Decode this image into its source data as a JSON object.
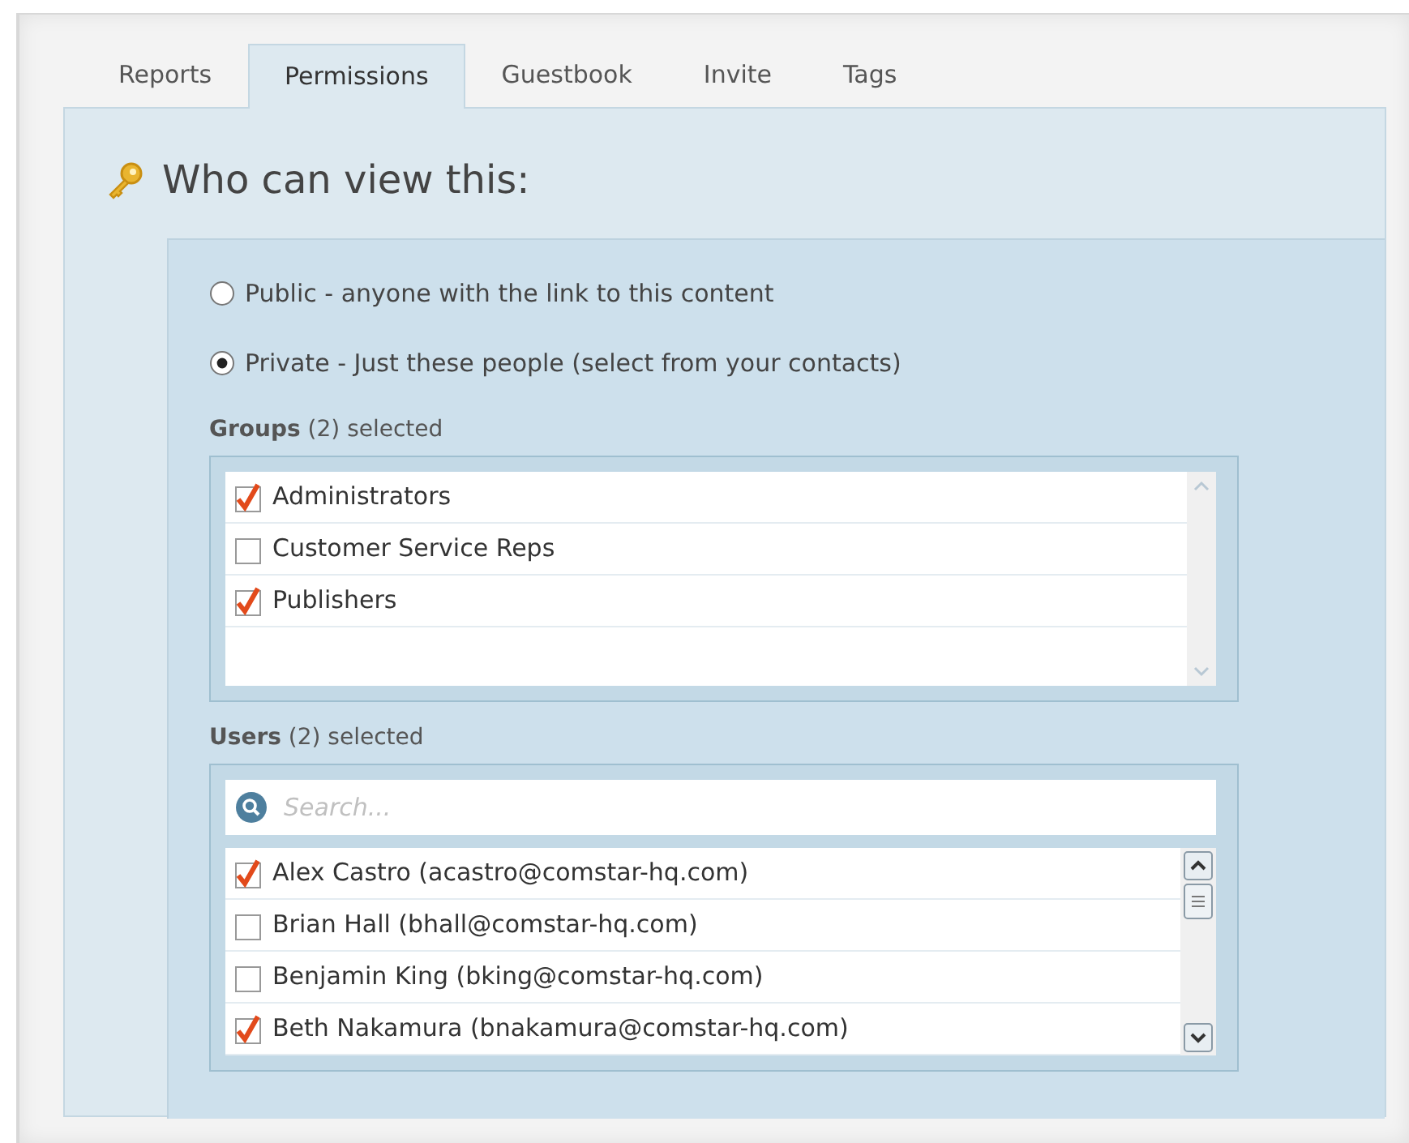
{
  "tabs": [
    {
      "label": "Reports",
      "selected": false
    },
    {
      "label": "Permissions",
      "selected": true
    },
    {
      "label": "Guestbook",
      "selected": false
    },
    {
      "label": "Invite",
      "selected": false
    },
    {
      "label": "Tags",
      "selected": false
    }
  ],
  "heading": "Who can view this:",
  "visibility": [
    {
      "label": "Public - anyone with the link to this content",
      "selected": false
    },
    {
      "label": "Private - Just these people (select from your contacts)",
      "selected": true
    }
  ],
  "groups": {
    "label": "**Groups** (2) selected",
    "items": [
      {
        "label": "Administrators",
        "checked": true
      },
      {
        "label": "Customer Service Reps",
        "checked": false
      },
      {
        "label": "Publishers",
        "checked": true
      }
    ]
  },
  "users": {
    "label": "**Users** (2) selected",
    "search": {
      "placeholder": "Search..."
    },
    "items": [
      {
        "label": "Alex Castro (acastro@comstar-hq.com)",
        "checked": true
      },
      {
        "label": "Brian Hall (bhall@comstar-hq.com)",
        "checked": false
      },
      {
        "label": "Benjamin King (bking@comstar-hq.com)",
        "checked": false
      },
      {
        "label": "Beth Nakamura (bnakamura@comstar-hq.com)",
        "checked": true
      }
    ]
  }
}
